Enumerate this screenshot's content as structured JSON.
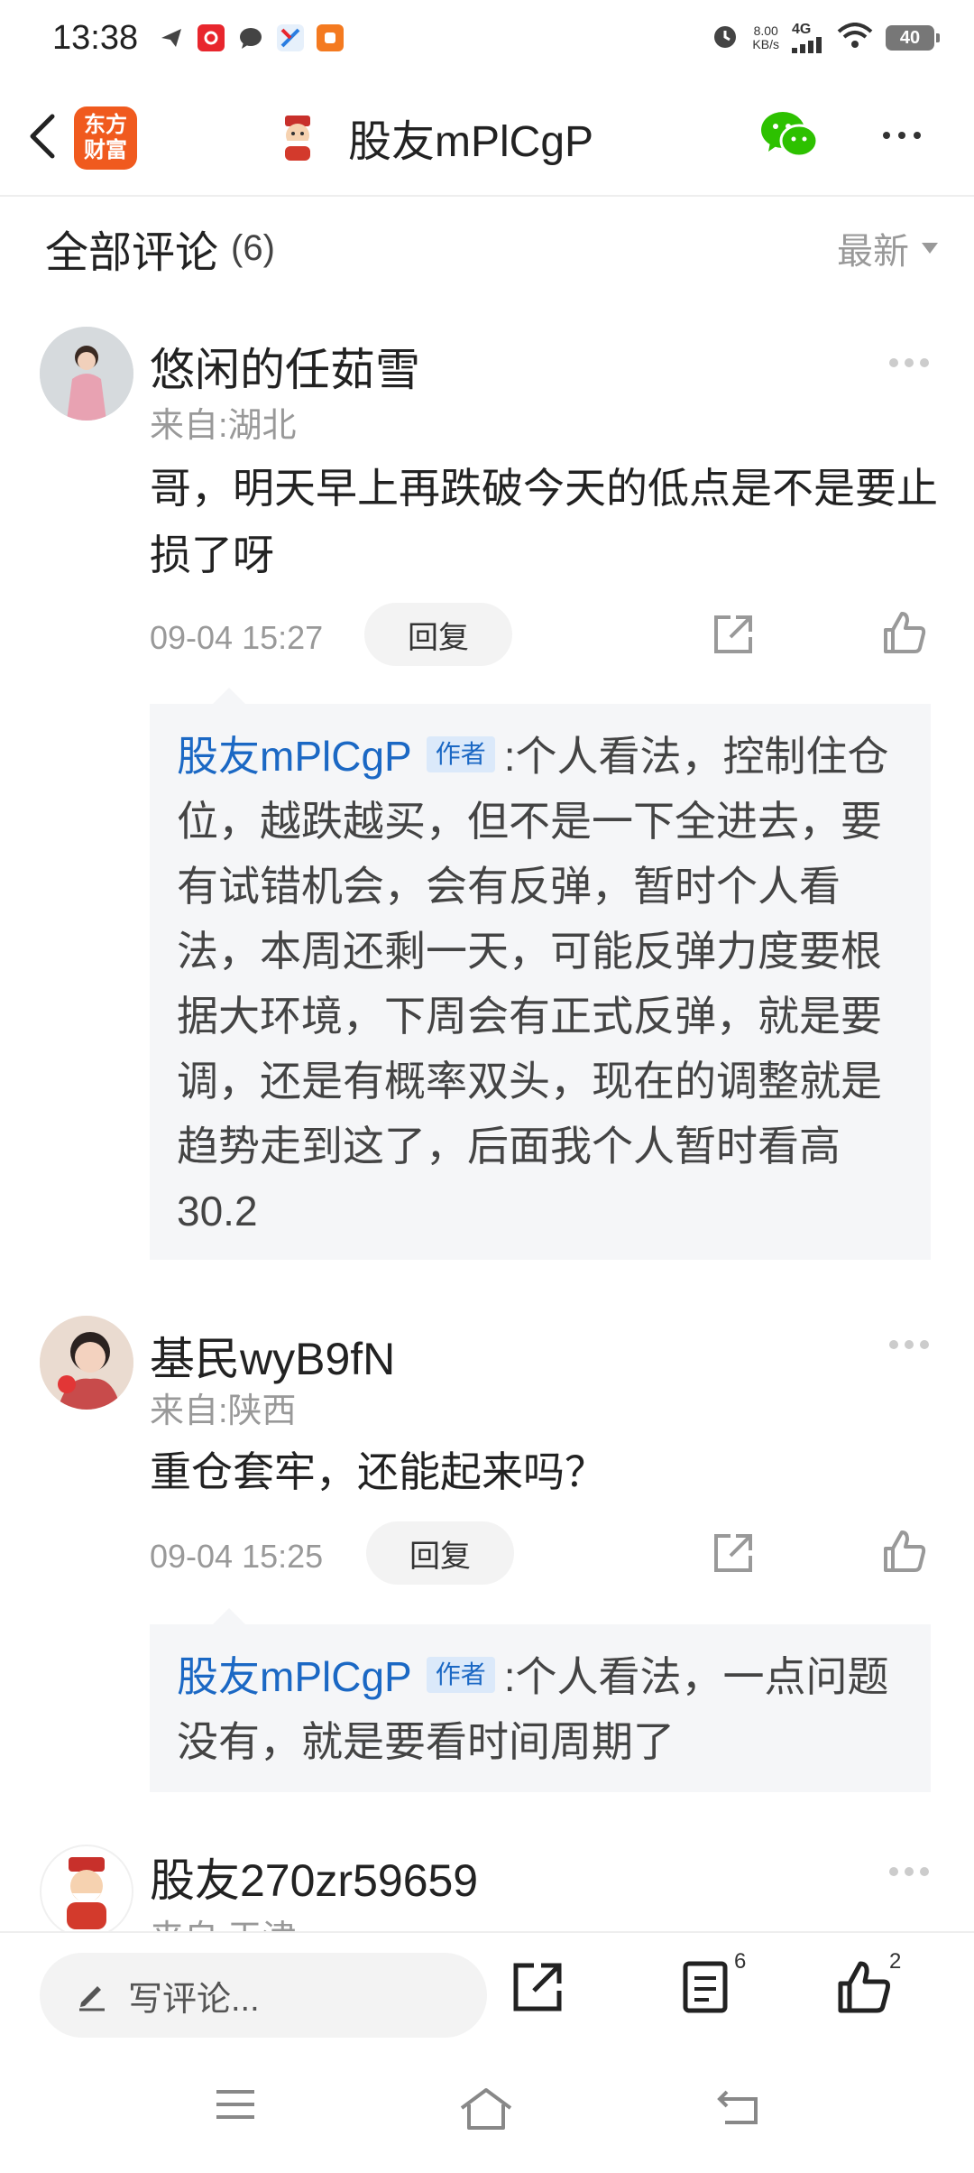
{
  "status": {
    "time": "13:38",
    "net_speed_value": "8.00",
    "net_speed_unit": "KB/s",
    "network": "4G",
    "battery": "40",
    "icons": [
      "send-icon",
      "app-red-icon",
      "chat-bubble-icon",
      "app-blue-icon",
      "app-orange-icon",
      "alarm-icon",
      "signal-icon",
      "wifi-icon"
    ]
  },
  "header": {
    "logo_text": "东方\n财富",
    "title": "股友mPlCgP",
    "share_icon": "wechat-icon"
  },
  "comments_section": {
    "title": "全部评论",
    "count": "(6)",
    "sort_label": "最新"
  },
  "comments": [
    {
      "name": "悠闲的任茹雪",
      "from": "来自:湖北",
      "text": "哥，明天早上再跌破今天的低点是不是要止损了呀",
      "time": "09-04 15:27",
      "reply_label": "回复",
      "reply": {
        "author": "股友mPlCgP",
        "tag": "作者",
        "text": ":个人看法，控制住仓位，越跌越买，但不是一下全进去，要有试错机会，会有反弹，暂时个人看法，本周还剩一天，可能反弹力度要根据大环境，下周会有正式反弹，就是要调，还是有概率双头，现在的调整就是趋势走到这了，后面我个人暂时看高30.2"
      }
    },
    {
      "name": "基民wyB9fN",
      "from": "来自:陕西",
      "text": "重仓套牢，还能起来吗？",
      "time": "09-04 15:25",
      "reply_label": "回复",
      "reply": {
        "author": "股友mPlCgP",
        "tag": "作者",
        "text": ":个人看法，一点问题没有，就是要看时间周期了"
      }
    },
    {
      "name": "股友270zr59659",
      "from": "来自:天津"
    }
  ],
  "bottom_bar": {
    "write_placeholder": "写评论...",
    "comments_badge": "6",
    "likes_badge": "2"
  },
  "colors": {
    "accent_blue": "#1b68c4",
    "logo_orange": "#f05a1e",
    "wechat_green": "#2dc100"
  }
}
